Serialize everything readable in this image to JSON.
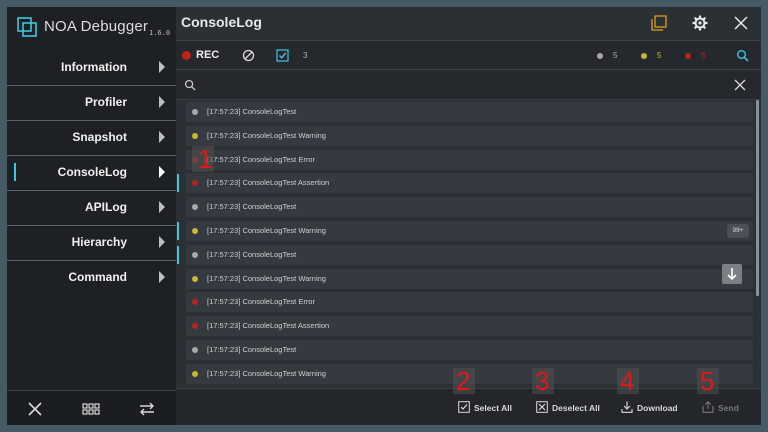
{
  "app": {
    "name": "NOA Debugger",
    "version": "1.6.0"
  },
  "sidebar": {
    "items": [
      {
        "label": "Information"
      },
      {
        "label": "Profiler"
      },
      {
        "label": "Snapshot"
      },
      {
        "label": "ConsoleLog"
      },
      {
        "label": "APILog"
      },
      {
        "label": "Hierarchy"
      },
      {
        "label": "Command"
      }
    ],
    "active_index": 3
  },
  "header": {
    "title": "ConsoleLog"
  },
  "toolbar": {
    "rec_label": "REC",
    "filter_count": "3",
    "log_count": "5",
    "warning_count": "5",
    "error_count": "5"
  },
  "colors": {
    "log": "#a8a8a8",
    "warning": "#c8b92c",
    "error": "#b8231b",
    "accent": "#3ec6e0",
    "rec": "#c0211b"
  },
  "logs": [
    {
      "text": "[17:57:23] ConsoleLogTest",
      "level": "log"
    },
    {
      "text": "[17:57:23] ConsoleLogTest Warning",
      "level": "warning"
    },
    {
      "text": "[17:57:23] ConsoleLogTest Error",
      "level": "error"
    },
    {
      "text": "[17:57:23] ConsoleLogTest Assertion",
      "level": "error"
    },
    {
      "text": "[17:57:23] ConsoleLogTest",
      "level": "log"
    },
    {
      "text": "[17:57:23] ConsoleLogTest Warning",
      "level": "warning"
    },
    {
      "text": "[17:57:23] ConsoleLogTest",
      "level": "log"
    },
    {
      "text": "[17:57:23] ConsoleLogTest Warning",
      "level": "warning"
    },
    {
      "text": "[17:57:23] ConsoleLogTest Error",
      "level": "error"
    },
    {
      "text": "[17:57:23] ConsoleLogTest Assertion",
      "level": "error"
    },
    {
      "text": "[17:57:23] ConsoleLogTest",
      "level": "log"
    },
    {
      "text": "[17:57:23] ConsoleLogTest Warning",
      "level": "warning"
    }
  ],
  "badge": "99+",
  "footer": {
    "select_all": "Select All",
    "deselect_all": "Deselect All",
    "download": "Download",
    "send": "Send"
  },
  "callouts": [
    "1",
    "2",
    "3",
    "4",
    "5"
  ]
}
